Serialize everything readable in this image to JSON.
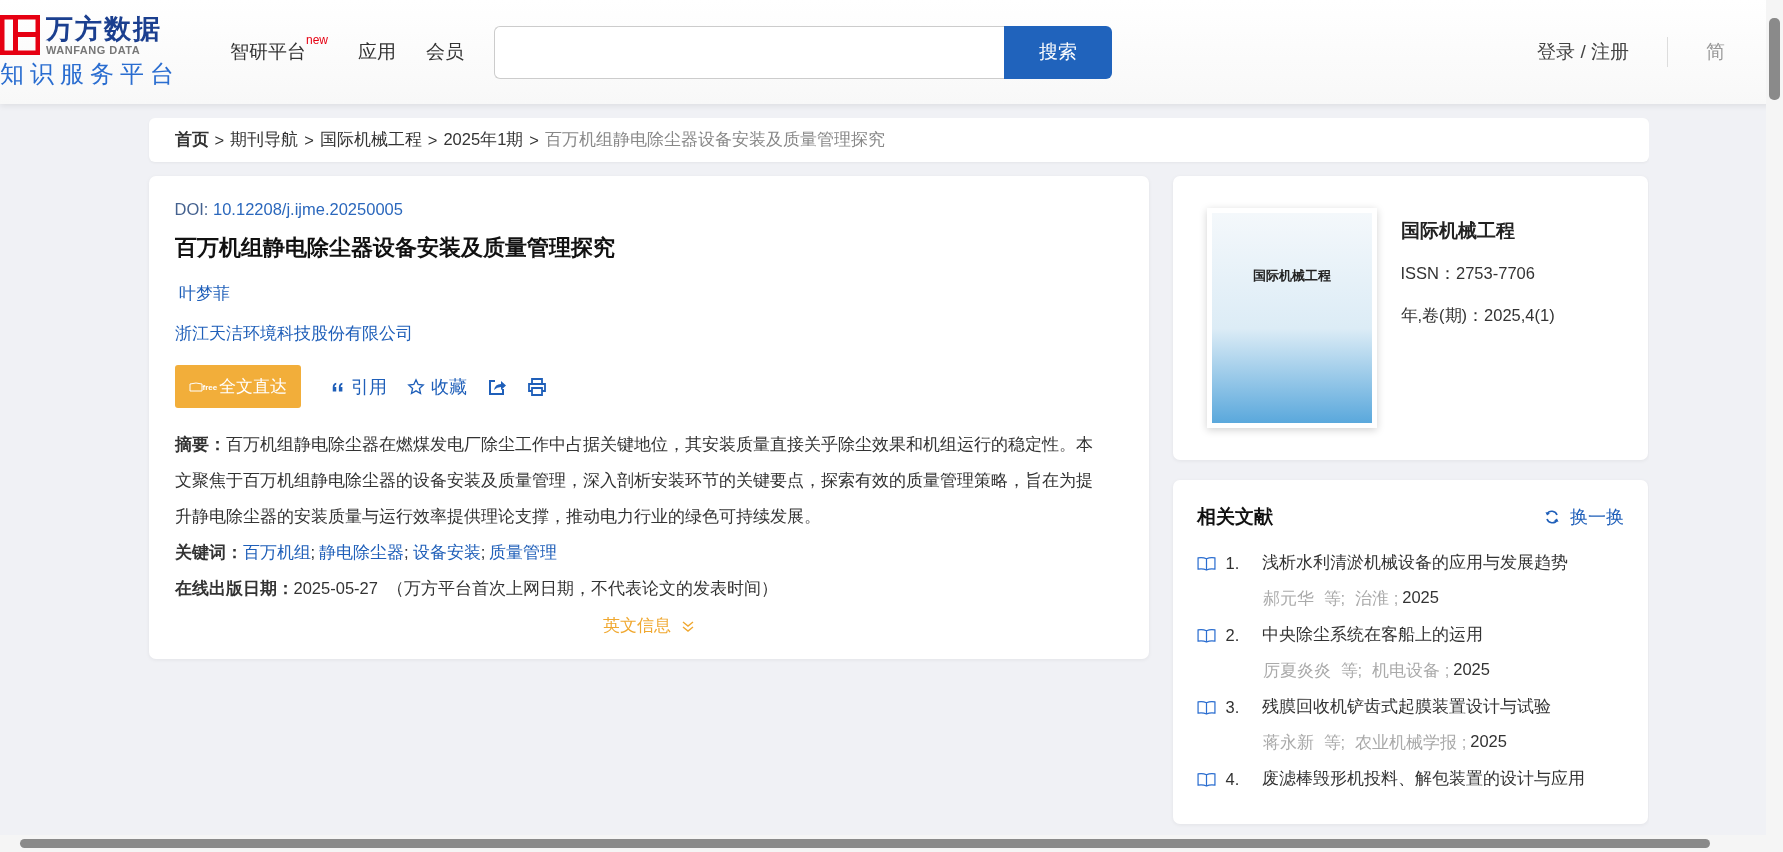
{
  "header": {
    "logo": {
      "name": "万方数据",
      "english": "WANFANG DATA",
      "subtitle": "知识服务平台"
    },
    "nav": [
      {
        "label": "智研平台",
        "badge": "new"
      },
      {
        "label": "应用"
      },
      {
        "label": "会员"
      }
    ],
    "search": {
      "button": "搜索"
    },
    "login": "登录 / 注册",
    "languages": [
      {
        "label": "简",
        "selected": true
      }
    ]
  },
  "breadcrumb": {
    "separator": ">",
    "items": [
      {
        "label": "首页",
        "kind": "home"
      },
      {
        "label": "期刊导航",
        "kind": "link"
      },
      {
        "label": "国际机械工程",
        "kind": "link"
      },
      {
        "label": "2025年1期",
        "kind": "link"
      },
      {
        "label": "百万机组静电除尘器设备安装及质量管理探究",
        "kind": "current"
      }
    ]
  },
  "article": {
    "doi_label": "DOI:",
    "doi": "10.12208/j.ijme.20250005",
    "title": "百万机组静电除尘器设备安装及质量管理探究",
    "authors": [
      "叶梦菲"
    ],
    "affiliations": [
      "浙江天洁环境科技股份有限公司"
    ],
    "actions": [
      {
        "kind": "fulltext",
        "label": "全文直达",
        "badge": "free"
      },
      {
        "kind": "cite",
        "label": "引用"
      },
      {
        "kind": "favorite",
        "label": "收藏"
      },
      {
        "kind": "share"
      },
      {
        "kind": "print"
      }
    ],
    "abstract_label": "摘要：",
    "abstract": "百万机组静电除尘器在燃煤发电厂除尘工作中占据关键地位，其安装质量直接关乎除尘效果和机组运行的稳定性。本文聚焦于百万机组静电除尘器的设备安装及质量管理，深入剖析安装环节的关键要点，探索有效的质量管理策略，旨在为提升静电除尘器的安装质量与运行效率提供理论支撑，推动电力行业的绿色可持续发展。",
    "keywords_label": "关键词：",
    "keyword_separator": ";",
    "keywords": [
      "百万机组",
      "静电除尘器",
      "设备安装",
      "质量管理"
    ],
    "date_label": "在线出版日期：",
    "date": "2025-05-27",
    "date_note": "（万方平台首次上网日期，不代表论文的发表时间）",
    "english_toggle": "英文信息"
  },
  "journal": {
    "cover_title": "国际机械工程",
    "name": "国际机械工程",
    "issn_label": "ISSN：",
    "issn": "2753-7706",
    "volume_label": "年,卷(期)：",
    "volume": "2025,4(1)"
  },
  "related": {
    "title": "相关文献",
    "refresh": "换一换",
    "items": [
      {
        "number": "1.",
        "title": "浅析水利清淤机械设备的应用与发展趋势",
        "authors": "郝元华",
        "et_al": "等;",
        "source": "治淮 ;",
        "year": "2025"
      },
      {
        "number": "2.",
        "title": "中央除尘系统在客船上的运用",
        "authors": "厉夏炎炎",
        "et_al": "等;",
        "source": "机电设备 ;",
        "year": "2025"
      },
      {
        "number": "3.",
        "title": "残膜回收机铲齿式起膜装置设计与试验",
        "authors": "蒋永新",
        "et_al": "等;",
        "source": "农业机械学报 ;",
        "year": "2025"
      },
      {
        "number": "4.",
        "title": "废滤棒毁形机投料、解包装置的设计与应用"
      }
    ]
  }
}
